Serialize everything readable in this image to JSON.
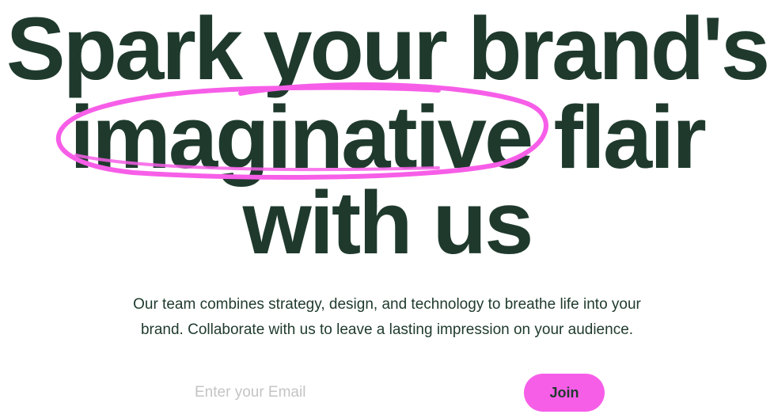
{
  "hero": {
    "headline": {
      "line1": "Spark your brand's",
      "highlight": "imaginative",
      "line2_rest": " flair",
      "line3": "with us"
    },
    "subtitle": {
      "line1": "Our team combines strategy, design, and technology to breathe life into your",
      "line2": "brand. Collaborate with us to leave a lasting impression on your audience."
    },
    "signup": {
      "email_placeholder": "Enter your Email",
      "email_value": "",
      "join_label": "Join"
    }
  },
  "colors": {
    "text": "#1f3a2d",
    "accent": "#f75ee8",
    "background": "#ffffff",
    "placeholder": "#c4c4c4"
  }
}
